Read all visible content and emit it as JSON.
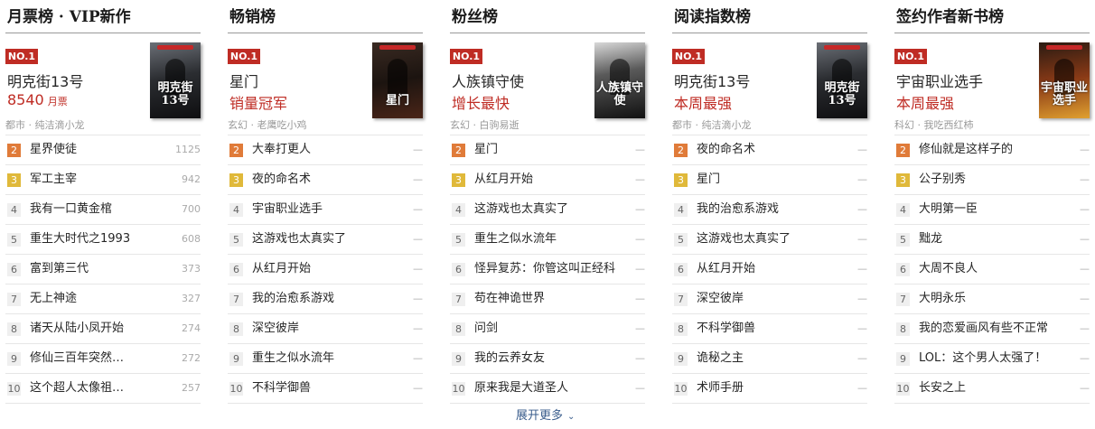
{
  "boards": [
    {
      "title": "月票榜 · VIP新作",
      "top": {
        "badge": "NO.1",
        "name": "明克街13号",
        "stat": "8540",
        "stat_unit": "月票",
        "meta": "都市 · 纯洁滴小龙",
        "cover_text": "明克街13号"
      },
      "rows": [
        {
          "rank": "2",
          "name": "星界使徒",
          "value": "1125"
        },
        {
          "rank": "3",
          "name": "军工主宰",
          "value": "942"
        },
        {
          "rank": "4",
          "name": "我有一口黄金棺",
          "value": "700"
        },
        {
          "rank": "5",
          "name": "重生大时代之1993",
          "value": "608"
        },
        {
          "rank": "6",
          "name": "富到第三代",
          "value": "373"
        },
        {
          "rank": "7",
          "name": "无上神途",
          "value": "327"
        },
        {
          "rank": "8",
          "name": "诸天从陆小凤开始",
          "value": "274"
        },
        {
          "rank": "9",
          "name": "修仙三百年突然…",
          "value": "272"
        },
        {
          "rank": "10",
          "name": "这个超人太像祖…",
          "value": "257"
        }
      ]
    },
    {
      "title": "畅销榜",
      "top": {
        "badge": "NO.1",
        "name": "星门",
        "stat": "销量冠军",
        "stat_unit": "",
        "meta": "玄幻 · 老鹰吃小鸡",
        "cover_text": "星门"
      },
      "rows": [
        {
          "rank": "2",
          "name": "大奉打更人",
          "value": "—"
        },
        {
          "rank": "3",
          "name": "夜的命名术",
          "value": "—"
        },
        {
          "rank": "4",
          "name": "宇宙职业选手",
          "value": "—"
        },
        {
          "rank": "5",
          "name": "这游戏也太真实了",
          "value": "—"
        },
        {
          "rank": "6",
          "name": "从红月开始",
          "value": "—"
        },
        {
          "rank": "7",
          "name": "我的治愈系游戏",
          "value": "—"
        },
        {
          "rank": "8",
          "name": "深空彼岸",
          "value": "—"
        },
        {
          "rank": "9",
          "name": "重生之似水流年",
          "value": "—"
        },
        {
          "rank": "10",
          "name": "不科学御兽",
          "value": "—"
        }
      ]
    },
    {
      "title": "粉丝榜",
      "top": {
        "badge": "NO.1",
        "name": "人族镇守使",
        "stat": "增长最快",
        "stat_unit": "",
        "meta": "玄幻 · 白驹易逝",
        "cover_text": "人族镇守使"
      },
      "rows": [
        {
          "rank": "2",
          "name": "星门",
          "value": "—"
        },
        {
          "rank": "3",
          "name": "从红月开始",
          "value": "—"
        },
        {
          "rank": "4",
          "name": "这游戏也太真实了",
          "value": "—"
        },
        {
          "rank": "5",
          "name": "重生之似水流年",
          "value": "—"
        },
        {
          "rank": "6",
          "name": "怪异复苏：你管这叫正经科",
          "value": "—"
        },
        {
          "rank": "7",
          "name": "苟在神诡世界",
          "value": "—"
        },
        {
          "rank": "8",
          "name": "问剑",
          "value": "—"
        },
        {
          "rank": "9",
          "name": "我的云养女友",
          "value": "—"
        },
        {
          "rank": "10",
          "name": "原来我是大道圣人",
          "value": "—"
        }
      ]
    },
    {
      "title": "阅读指数榜",
      "top": {
        "badge": "NO.1",
        "name": "明克街13号",
        "stat": "本周最强",
        "stat_unit": "",
        "meta": "都市 · 纯洁滴小龙",
        "cover_text": "明克街13号"
      },
      "rows": [
        {
          "rank": "2",
          "name": "夜的命名术",
          "value": "—"
        },
        {
          "rank": "3",
          "name": "星门",
          "value": "—"
        },
        {
          "rank": "4",
          "name": "我的治愈系游戏",
          "value": "—"
        },
        {
          "rank": "5",
          "name": "这游戏也太真实了",
          "value": "—"
        },
        {
          "rank": "6",
          "name": "从红月开始",
          "value": "—"
        },
        {
          "rank": "7",
          "name": "深空彼岸",
          "value": "—"
        },
        {
          "rank": "8",
          "name": "不科学御兽",
          "value": "—"
        },
        {
          "rank": "9",
          "name": "诡秘之主",
          "value": "—"
        },
        {
          "rank": "10",
          "name": "术师手册",
          "value": "—"
        }
      ]
    },
    {
      "title": "签约作者新书榜",
      "top": {
        "badge": "NO.1",
        "name": "宇宙职业选手",
        "stat": "本周最强",
        "stat_unit": "",
        "meta": "科幻 · 我吃西红柿",
        "cover_text": "宇宙职业选手"
      },
      "rows": [
        {
          "rank": "2",
          "name": "修仙就是这样子的",
          "value": "—"
        },
        {
          "rank": "3",
          "name": "公子别秀",
          "value": "—"
        },
        {
          "rank": "4",
          "name": "大明第一臣",
          "value": "—"
        },
        {
          "rank": "5",
          "name": "黜龙",
          "value": "—"
        },
        {
          "rank": "6",
          "name": "大周不良人",
          "value": "—"
        },
        {
          "rank": "7",
          "name": "大明永乐",
          "value": "—"
        },
        {
          "rank": "8",
          "name": "我的恋爱画风有些不正常",
          "value": "—"
        },
        {
          "rank": "9",
          "name": "LOL：这个男人太强了！",
          "value": "—"
        },
        {
          "rank": "10",
          "name": "长安之上",
          "value": "—"
        }
      ]
    }
  ],
  "more": {
    "label": "展开更多"
  },
  "colors": {
    "accent": "#bf2c24",
    "rank2": "#e07b39",
    "rank3": "#e0b93a",
    "link": "#3a5d8c"
  }
}
